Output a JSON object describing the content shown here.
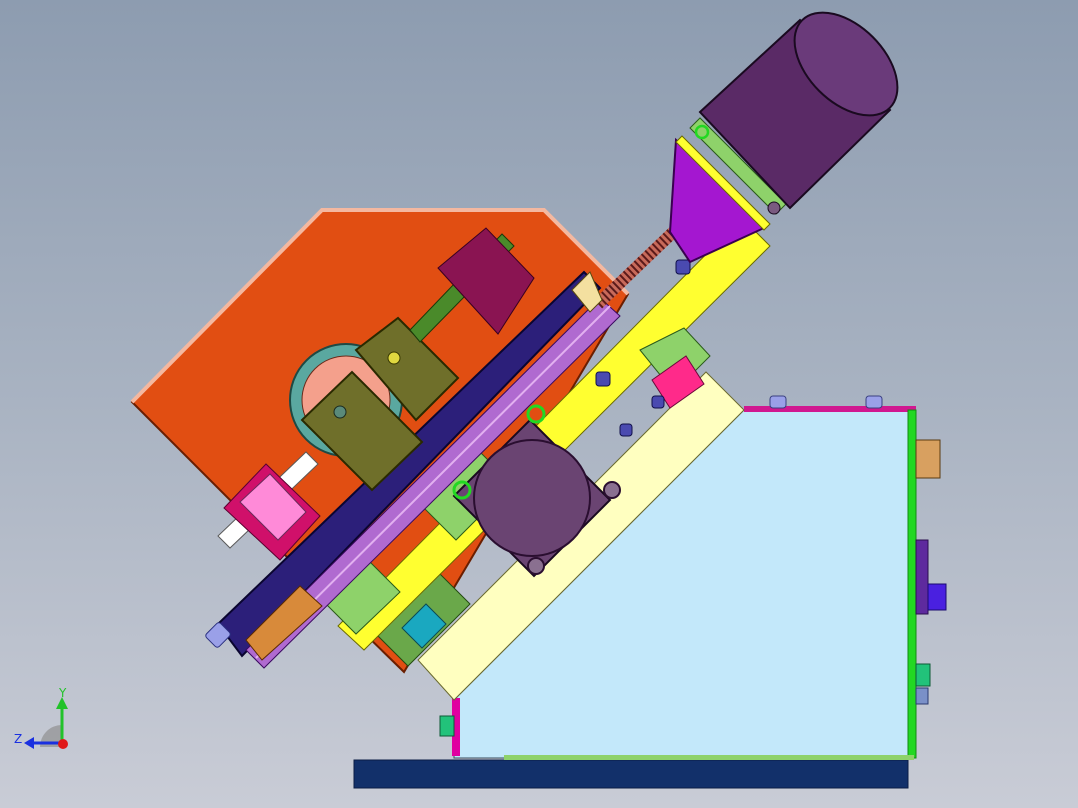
{
  "viewport": {
    "colors": {
      "background_top": "#8d9cb0",
      "background_bottom": "#c9ccd6",
      "frame_plate": "#e14e12",
      "frame_edge": "#f4b8a0",
      "base_box": "#c3e8fa",
      "base_box_top": "#ffffc0",
      "bottom_rail": "#12306a",
      "motor_body": "#5a2a66",
      "motor_mount": "#a417d0",
      "slide_rail": "#2c1f7a",
      "linear_guide": "#b06ad0",
      "yellow_plate": "#ffff30",
      "olive_block": "#6f6f2a",
      "green_block": "#8ed26a",
      "step_motor": "#6a4472",
      "magenta_part": "#ff6ad8",
      "green_edge": "#22d822",
      "accent_magenta": "#e000a0"
    }
  },
  "triad": {
    "y_label": "Y",
    "z_label": "Z",
    "colors": {
      "y": "#22c22a",
      "z": "#1a30e0",
      "origin": "#e01818"
    }
  }
}
